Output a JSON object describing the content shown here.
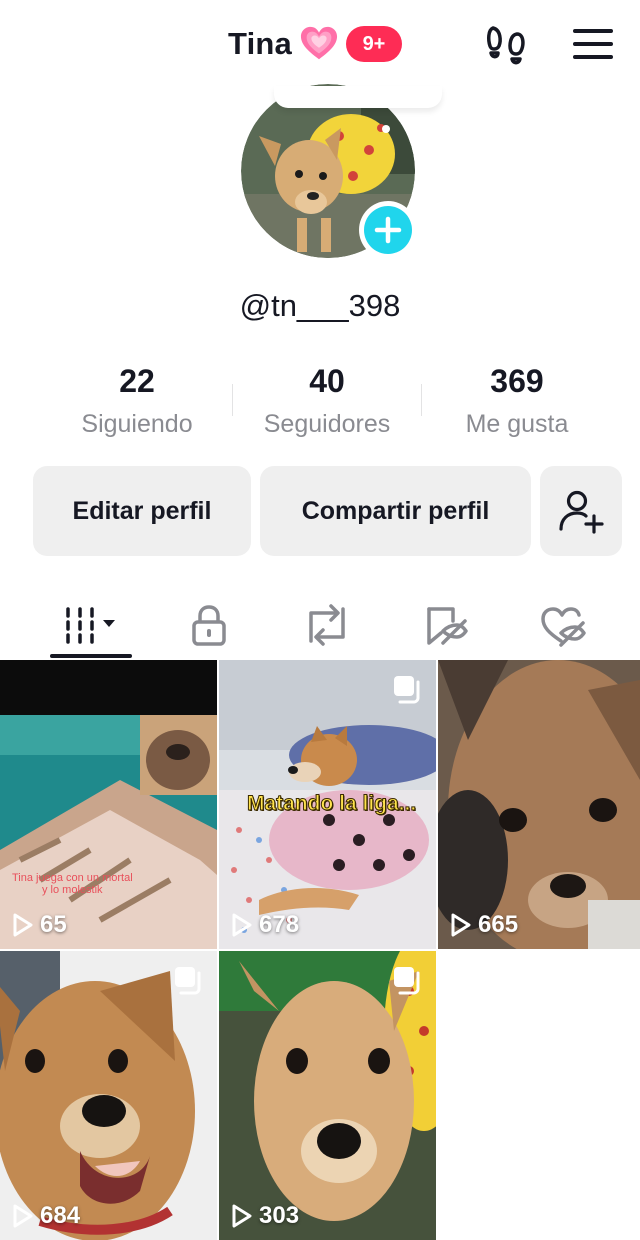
{
  "header": {
    "title": "Tina",
    "heart_emoji": "💗",
    "notification_badge": "9+",
    "icons": [
      "footprint-icon",
      "menu-icon"
    ]
  },
  "profile": {
    "handle": "@tn___398",
    "avatar_alt": "avatar"
  },
  "stats": [
    {
      "value": "22",
      "label": "Siguiendo"
    },
    {
      "value": "40",
      "label": "Seguidores"
    },
    {
      "value": "369",
      "label": "Me gusta"
    }
  ],
  "actions": {
    "edit": "Editar perfil",
    "share": "Compartir perfil"
  },
  "tabs": [
    "videos-grid-icon",
    "lock-icon",
    "repost-icon",
    "saved-icon",
    "liked-icon"
  ],
  "videos": [
    {
      "views": "65",
      "caption_line1": "Tina juega con un mortal",
      "caption_line2": "y lo molestik"
    },
    {
      "views": "678",
      "sticker": "Matando la liga..."
    },
    {
      "views": "665"
    },
    {
      "views": "684"
    },
    {
      "views": "303"
    }
  ],
  "colors": {
    "accent": "#fe2c55",
    "avatar_add": "#20d5ec",
    "muted": "#8a8b91",
    "button_bg": "#efefef"
  }
}
